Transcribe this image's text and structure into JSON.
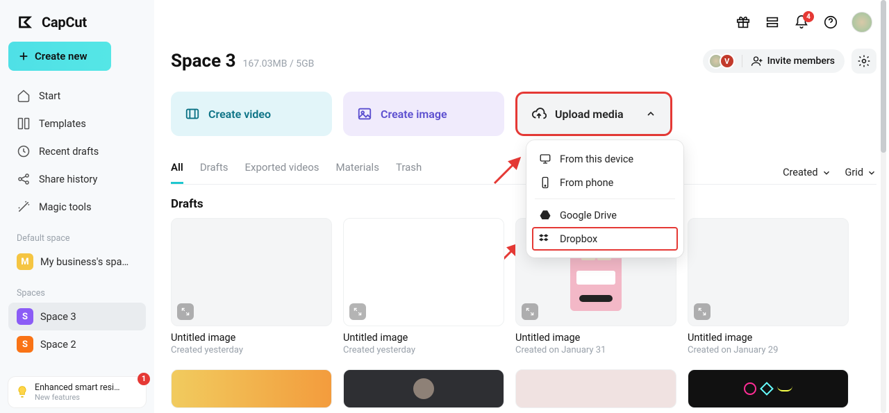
{
  "app": {
    "name": "CapCut"
  },
  "sidebar": {
    "createLabel": "Create new",
    "nav": [
      {
        "label": "Start"
      },
      {
        "label": "Templates"
      },
      {
        "label": "Recent drafts"
      },
      {
        "label": "Share history"
      },
      {
        "label": "Magic tools"
      }
    ],
    "defaultSpaceLabel": "Default space",
    "defaultSpace": {
      "initial": "M",
      "name": "My business's spa…"
    },
    "spacesLabel": "Spaces",
    "spaces": [
      {
        "initial": "S",
        "name": "Space 3",
        "active": true
      },
      {
        "initial": "S",
        "name": "Space 2",
        "active": false
      }
    ],
    "feature": {
      "title": "Enhanced smart resi…",
      "subtitle": "New features",
      "badge": "1"
    }
  },
  "topbar": {
    "notificationBadge": "4"
  },
  "page": {
    "title": "Space 3",
    "quota": "167.03MB / 5GB",
    "memberInitial": "V",
    "inviteLabel": "Invite members"
  },
  "actions": {
    "video": "Create video",
    "image": "Create image",
    "upload": "Upload media"
  },
  "uploadMenu": {
    "device": "From this device",
    "phone": "From phone",
    "gdrive": "Google Drive",
    "dropbox": "Dropbox"
  },
  "tabs": {
    "items": [
      "All",
      "Drafts",
      "Exported videos",
      "Materials",
      "Trash"
    ],
    "activeIndex": 0,
    "sort": "Created",
    "view": "Grid"
  },
  "draftsSection": {
    "title": "Drafts",
    "items": [
      {
        "title": "Untitled image",
        "date": "Created yesterday"
      },
      {
        "title": "Untitled image",
        "date": "Created yesterday"
      },
      {
        "title": "Untitled image",
        "date": "Created on January 31"
      },
      {
        "title": "Untitled image",
        "date": "Created on January 29"
      }
    ]
  }
}
